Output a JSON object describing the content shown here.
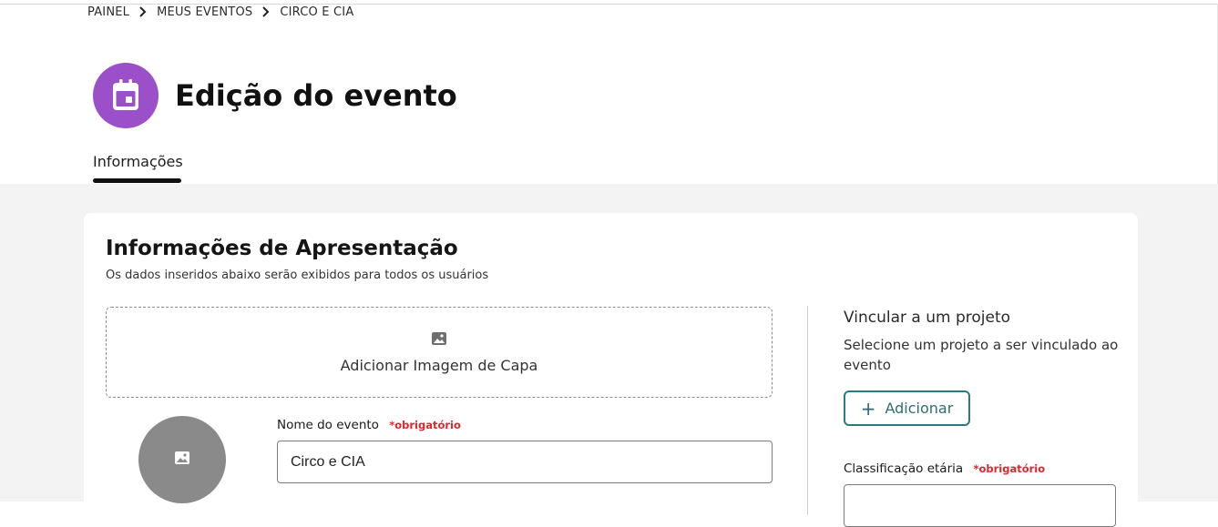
{
  "breadcrumb": {
    "items": [
      "PAINEL",
      "MEUS EVENTOS",
      "CIRCO E CIA"
    ]
  },
  "header": {
    "title": "Edição do evento",
    "icon": "calendar-icon",
    "icon_bg": "#9b4fc9"
  },
  "tabs": [
    {
      "label": "Informações",
      "active": true
    }
  ],
  "card": {
    "title": "Informações de Apresentação",
    "subtitle": "Os dados inseridos abaixo serão exibidos para todos os usuários",
    "cover": {
      "label": "Adicionar Imagem de Capa",
      "icon": "image-icon"
    },
    "avatar": {
      "icon": "image-icon"
    },
    "event_name": {
      "label": "Nome do evento",
      "required_label": "*obrigatório",
      "value": "Circo e CIA"
    }
  },
  "sidebar": {
    "project": {
      "title": "Vincular a um projeto",
      "description": "Selecione um projeto a ser vinculado ao evento",
      "add_label": "Adicionar",
      "add_icon": "plus-icon"
    },
    "age_rating": {
      "label": "Classificação etária",
      "required_label": "*obrigatório",
      "value": ""
    }
  },
  "colors": {
    "accent": "#2a7a80",
    "required": "#e0262d",
    "page_background": "#f3f3f3"
  }
}
